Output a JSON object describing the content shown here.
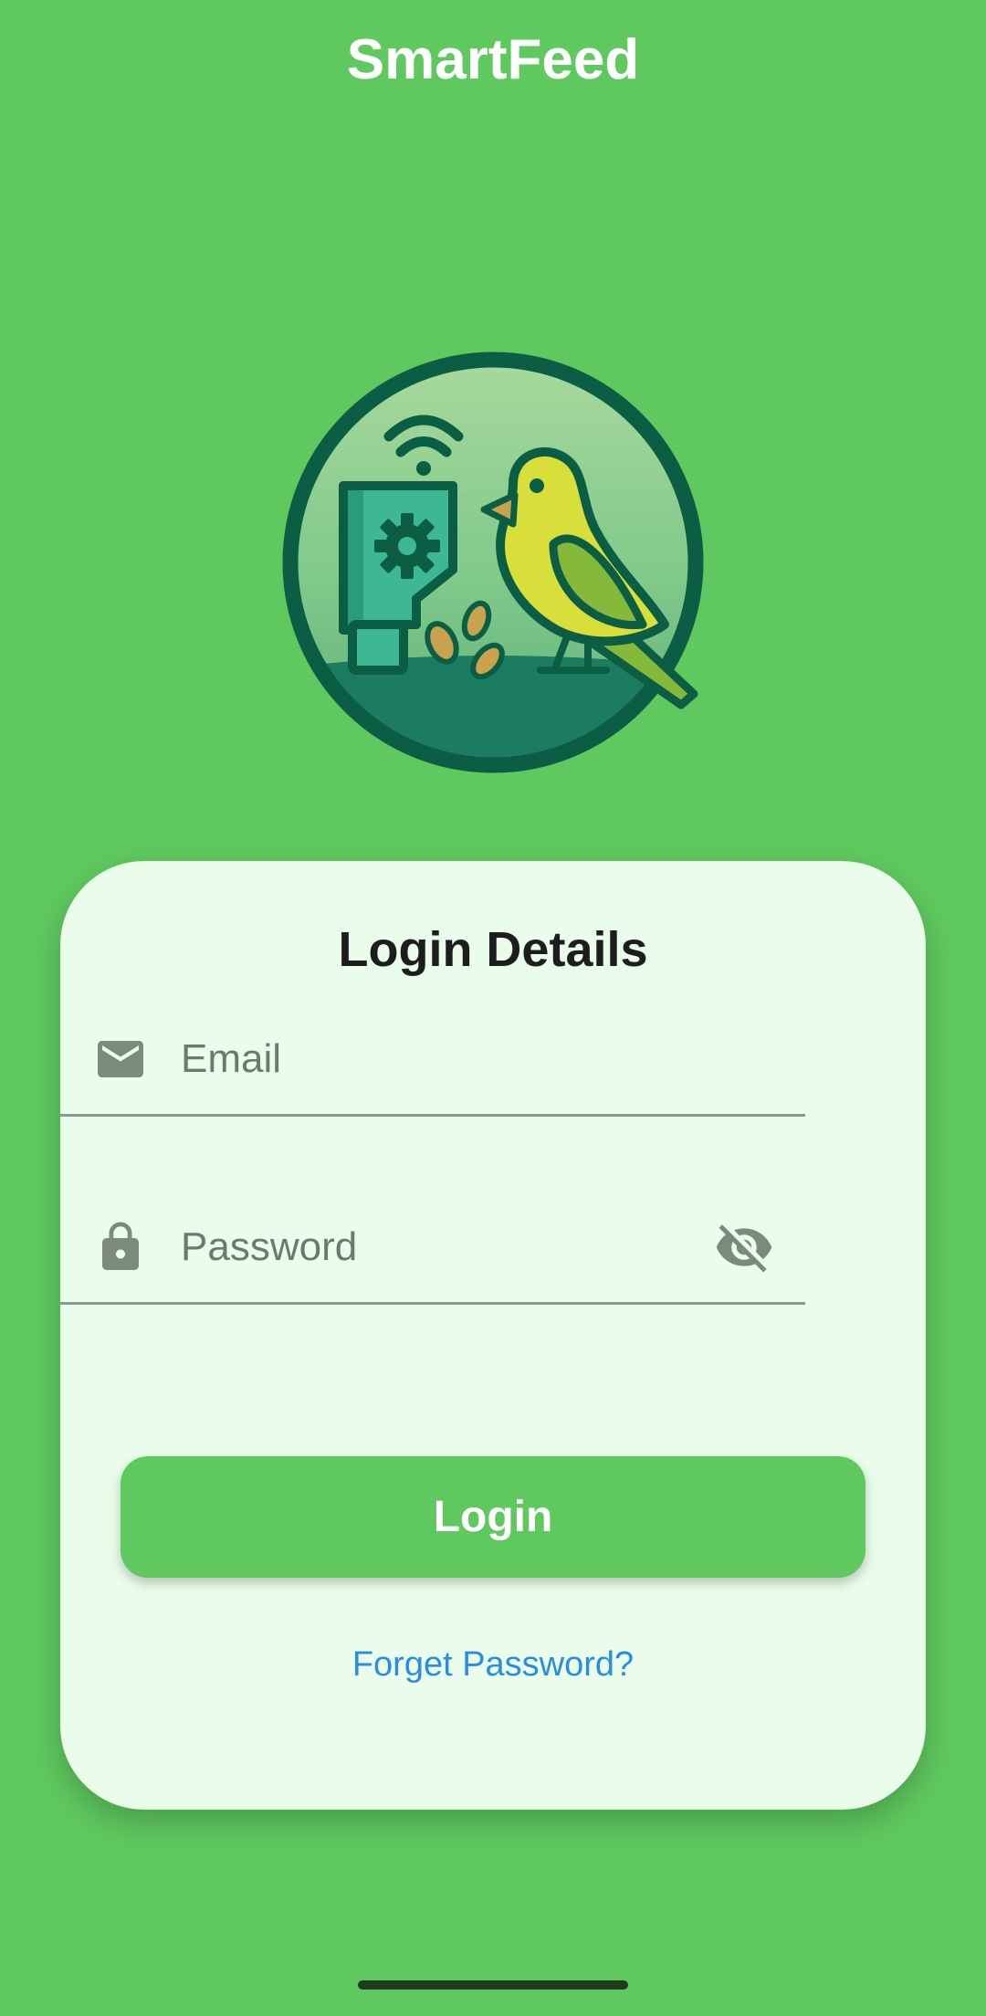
{
  "app": {
    "title": "SmartFeed"
  },
  "logo": {
    "icon": "bird-feeder-logo-icon"
  },
  "login_card": {
    "title": "Login Details",
    "email": {
      "placeholder": "Email",
      "value": "",
      "icon": "email-icon"
    },
    "password": {
      "placeholder": "Password",
      "value": "",
      "icon": "lock-icon",
      "toggle_icon": "visibility-off-icon"
    },
    "login_button_label": "Login",
    "forgot_password_label": "Forget Password?"
  },
  "colors": {
    "background": "#5fc95f",
    "card": "#e9fdea",
    "primary": "#5fc95f",
    "link": "#2a8de2",
    "icon": "#7b8a7d",
    "logo_dark": "#0b5e44",
    "logo_teal": "#3db892",
    "bird_yellow": "#d8de3a",
    "bird_green": "#84b93a"
  }
}
